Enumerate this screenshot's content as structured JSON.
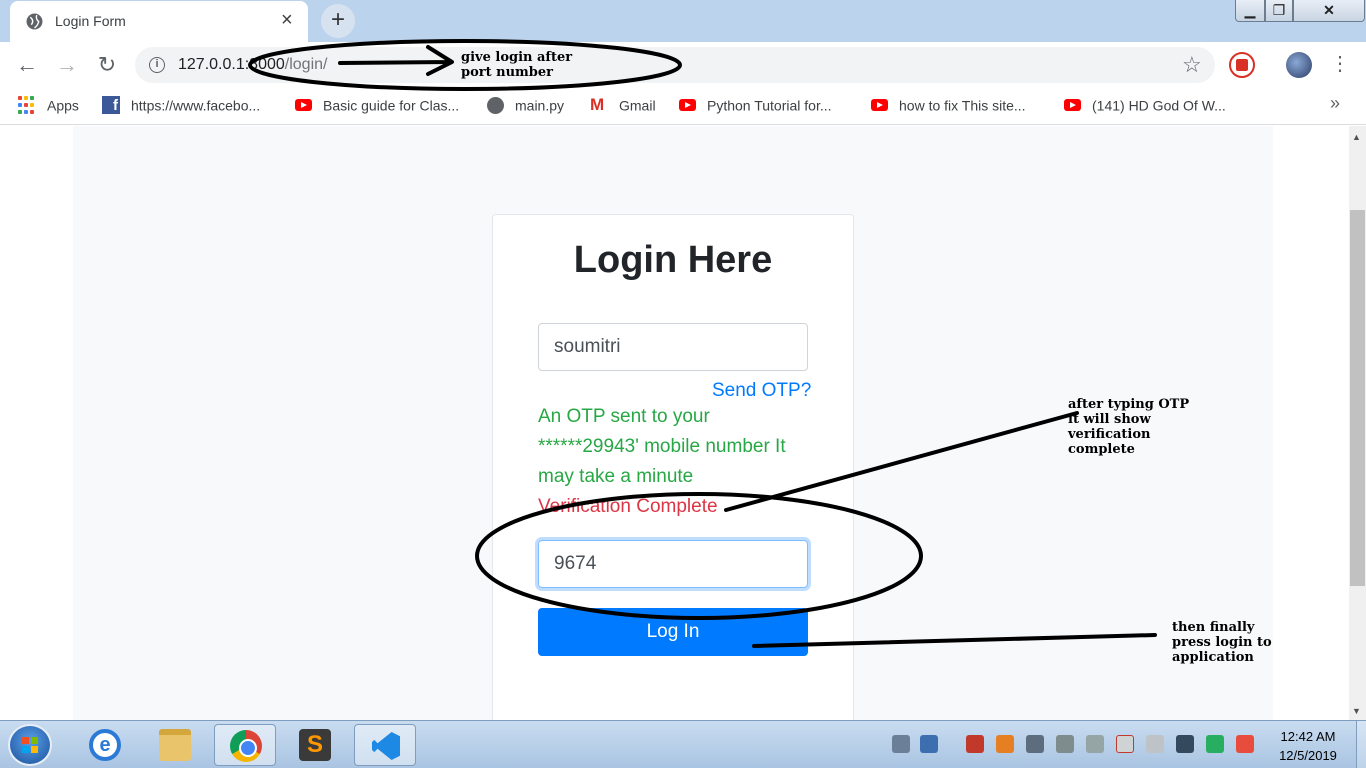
{
  "browser": {
    "tab_title": "Login Form",
    "tab_close": "×",
    "new_tab": "+",
    "url_host": "127.0.0.1:8000",
    "url_path": "/login/",
    "bookmarks": [
      {
        "label": "Apps",
        "icon": "apps-grid-icon"
      },
      {
        "label": "https://www.facebo...",
        "icon": "facebook-icon"
      },
      {
        "label": "Basic guide for Clas...",
        "icon": "youtube-icon"
      },
      {
        "label": "main.py",
        "icon": "globe-icon"
      },
      {
        "label": "Gmail",
        "icon": "gmail-icon"
      },
      {
        "label": "Python Tutorial for...",
        "icon": "youtube-icon"
      },
      {
        "label": "how to fix This site...",
        "icon": "youtube-icon"
      },
      {
        "label": "(141) HD God Of W...",
        "icon": "youtube-icon"
      }
    ],
    "more_bookmarks": "»"
  },
  "form": {
    "title": "Login Here",
    "username_value": "soumitri",
    "send_otp_label": "Send OTP?",
    "otp_message": "An OTP sent to your ******29943' mobile number It may take a minute",
    "verification_message": "Verification Complete",
    "otp_value": "9674",
    "login_label": "Log In"
  },
  "annotations": {
    "url_note_line1": "give login after",
    "url_note_line2": "port number",
    "otp_note_line1": "after typing OTP",
    "otp_note_line2": "it will show",
    "otp_note_line3": "verification",
    "otp_note_line4": "complete",
    "login_note_line1": "then finally",
    "login_note_line2": "press login to",
    "login_note_line3": "application"
  },
  "taskbar": {
    "time": "12:42 AM",
    "date": "12/5/2019"
  },
  "colors": {
    "primary": "#007bff",
    "success": "#28a745",
    "danger": "#dc3545"
  }
}
